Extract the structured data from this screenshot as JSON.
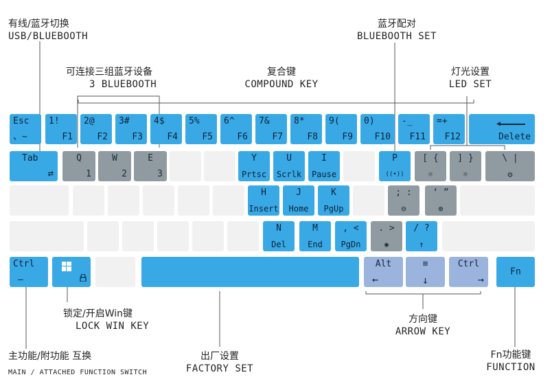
{
  "annotations": {
    "usb_bt": {
      "zh": "有线/蓝牙切换",
      "en": "USB/BLUEBOOTH"
    },
    "three_bt": {
      "zh": "可连接三组蓝牙设备",
      "en": "3 BLUEBOOTH"
    },
    "compound": {
      "zh": "复合键",
      "en": "COMPOUND KEY"
    },
    "bt_set": {
      "zh": "蓝牙配对",
      "en": "BLUEBOOTH SET"
    },
    "led_set": {
      "zh": "灯光设置",
      "en": "LED SET"
    },
    "lock_win": {
      "zh": "锁定/开启Win键",
      "en": "LOCK WIN KEY"
    },
    "direction": {
      "zh": "方向键",
      "en": "ARROW KEY"
    },
    "main_fn": {
      "zh": "主功能/附功能 互换",
      "en": "MAIN / ATTACHED FUNCTION SWITCH"
    },
    "factory": {
      "zh": "出厂设置",
      "en": "FACTORY SET"
    },
    "fn_key": {
      "zh": "Fn功能键",
      "en": "FUNCTION"
    }
  },
  "keys": {
    "esc": {
      "top": "Esc",
      "bot": "、~"
    },
    "f1": {
      "top": "1!",
      "bot": "F1"
    },
    "f2": {
      "top": "2@",
      "bot": "F2"
    },
    "f3": {
      "top": "3#",
      "bot": "F3"
    },
    "f4": {
      "top": "4$",
      "bot": "F4"
    },
    "f5": {
      "top": "5%",
      "bot": "F5"
    },
    "f6": {
      "top": "6^",
      "bot": "F6"
    },
    "f7": {
      "top": "7&",
      "bot": "F7"
    },
    "f8": {
      "top": "8*",
      "bot": "F8"
    },
    "f9": {
      "top": "9(",
      "bot": "F9"
    },
    "f10": {
      "top": "0)",
      "bot": "F10"
    },
    "f11": {
      "top": "-_",
      "bot": "F11"
    },
    "f12": {
      "top": "=+",
      "bot": "F12"
    },
    "delete": {
      "bot": "Delete"
    },
    "tab": {
      "top": "Tab"
    },
    "q": {
      "top": "Q",
      "bot": "1"
    },
    "w": {
      "top": "W",
      "bot": "2"
    },
    "e": {
      "top": "E",
      "bot": "3"
    },
    "y": {
      "top": "Y",
      "bot": "Prtsc"
    },
    "u": {
      "top": "U",
      "bot": "Scrlk"
    },
    "i": {
      "top": "I",
      "bot": "Pause"
    },
    "p": {
      "top": "P",
      "bot": "((•))"
    },
    "lbr": {
      "top": "[ {",
      "bot": "☼"
    },
    "rbr": {
      "top": "] }",
      "bot": "☼"
    },
    "bsl": {
      "top": "\\ |",
      "bot": "⚙"
    },
    "h": {
      "top": "H",
      "bot": "Insert"
    },
    "j": {
      "top": "J",
      "bot": "Home"
    },
    "k": {
      "top": "K",
      "bot": "PgUp"
    },
    "semi": {
      "top": "; :",
      "bot": "⊖"
    },
    "quote": {
      "top": "‘ ”",
      "bot": "⊕"
    },
    "n": {
      "top": "N",
      "bot": "Del"
    },
    "m": {
      "top": "M",
      "bot": "End"
    },
    "comma": {
      "top": ", <",
      "bot": "PgDn"
    },
    "period": {
      "top": ". >",
      "bot": "✺"
    },
    "slash": {
      "top": "/ ?",
      "bot": "↑"
    },
    "ctrl_l": {
      "top": "Ctrl",
      "bot": "—"
    },
    "win": {
      "bot": "🔒"
    },
    "alt": {
      "top": "Alt",
      "bot": "←"
    },
    "menu": {
      "top": "≡",
      "bot": "↓"
    },
    "ctrl_r": {
      "top": "Ctrl",
      "bot": "→"
    },
    "fn": {
      "top": "Fn"
    }
  }
}
